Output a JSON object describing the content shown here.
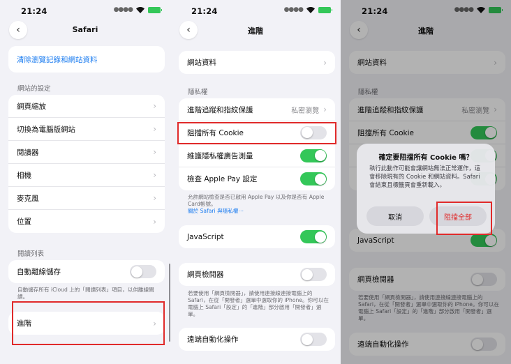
{
  "status": {
    "time": "21:24"
  },
  "p1": {
    "title": "Safari",
    "clear_history": "清除瀏覽記錄和網站資料",
    "section_website": "網站的設定",
    "website_items": [
      "網頁縮放",
      "切換為電腦版網站",
      "閱讀器",
      "相機",
      "麥克風",
      "位置"
    ],
    "section_reading": "閱讀列表",
    "offline_label": "自動離線儲存",
    "offline_note": "自動儲存所有 iCloud 上的「閱讀列表」項目，以供離線閱讀。",
    "advanced_label": "進階"
  },
  "p2": {
    "title": "進階",
    "website_data": "網站資料",
    "section_privacy": "隱私權",
    "tracking_label": "進階追蹤和指紋保護",
    "tracking_value": "私密瀏覽",
    "block_cookies": "阻擋所有 Cookie",
    "ad_measure": "維護隱私權廣告測量",
    "apple_pay": "檢查 Apple Pay 設定",
    "privacy_note": "允許網站檢查是否已啟用 Apple Pay 以及你是否有 Apple Card帳號。",
    "privacy_link": "關於 Safari 與隱私權⋯",
    "javascript": "JavaScript",
    "web_inspector": "網頁檢閱器",
    "inspector_note": "若要使用「網頁檢閱器」，請使用連接線連接電腦上的 Safari，在從「開發者」選單中選取你的 iPhone。你可以在電腦上 Safari「設定」的「進階」部分啟用「開發者」選單。",
    "remote_automation": "遠端自動化操作"
  },
  "p3": {
    "title": "進階",
    "website_data": "網站資料",
    "section_privacy": "隱私權",
    "tracking_label": "進階追蹤和指紋保護",
    "tracking_value": "私密瀏覽",
    "block_cookies": "阻擋所有 Cookie",
    "javascript": "JavaScript",
    "web_inspector": "網頁檢閱器",
    "inspector_note": "若要使用「網頁檢閱器」，請使用連接線連接電腦上的 Safari，在從「開發者」選單中選取你的 iPhone。你可以在電腦上 Safari「設定」的「進階」部分啟用「開發者」選單。",
    "remote_automation": "遠端自動化操作",
    "alert": {
      "title": "確定要阻擋所有 Cookie 嗎？",
      "message": "執行此動作可能會讓網站無法正常運作，這會移除現有的 Cookie 和網站資料。Safari 會結束且標籤頁會重新載入。",
      "cancel": "取消",
      "block_all": "阻擋全部"
    }
  },
  "colors": {
    "accent": "#1b7cf0",
    "toggle_on": "#34c759",
    "destructive": "#e02a2a",
    "highlight": "#e02a2a"
  }
}
